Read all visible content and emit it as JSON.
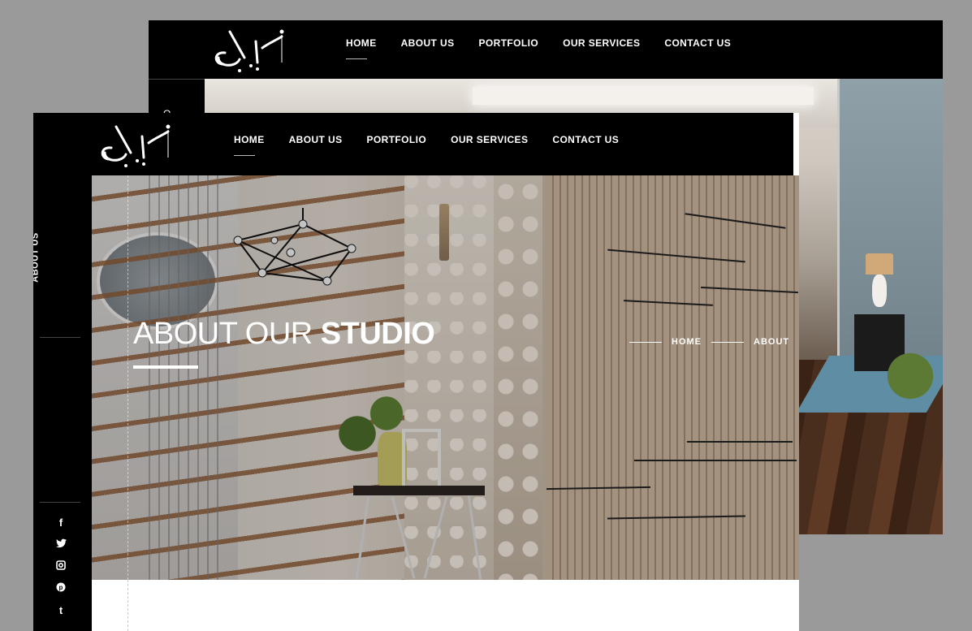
{
  "nav": {
    "items": [
      {
        "label": "HOME",
        "active": true
      },
      {
        "label": "ABOUT US",
        "active": false
      },
      {
        "label": "PORTFOLIO",
        "active": false
      },
      {
        "label": "OUR SERVICES",
        "active": false
      },
      {
        "label": "CONTACT US",
        "active": false
      }
    ]
  },
  "sidebar": {
    "label": "ABOUT US",
    "social": [
      {
        "icon": "facebook-icon",
        "glyph": "f"
      },
      {
        "icon": "twitter-icon",
        "glyph": "🐦"
      },
      {
        "icon": "instagram-icon",
        "glyph": "◙"
      },
      {
        "icon": "pinterest-icon",
        "glyph": "℗"
      },
      {
        "icon": "tumblr-icon",
        "glyph": "t"
      }
    ]
  },
  "back_sidebar_glyph": "O",
  "hero": {
    "title_light": "ABOUT OUR ",
    "title_bold": "STUDIO",
    "breadcrumb": [
      "HOME",
      "ABOUT"
    ]
  },
  "colors": {
    "nav_bg": "#000000",
    "backdrop": "#9a9a9a",
    "text": "#ffffff"
  }
}
